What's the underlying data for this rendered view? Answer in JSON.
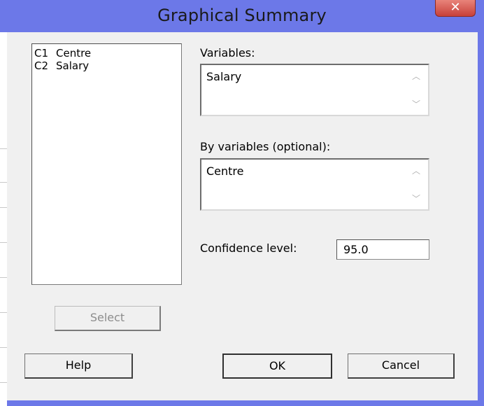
{
  "window": {
    "title": "Graphical Summary",
    "close_label": "✕"
  },
  "variable_list": {
    "items": [
      {
        "column": "C1",
        "name": "Centre"
      },
      {
        "column": "C2",
        "name": "Salary"
      }
    ]
  },
  "variables": {
    "label": "Variables:",
    "value": "Salary"
  },
  "by_variables": {
    "label": "By variables (optional):",
    "value": "Centre"
  },
  "confidence": {
    "label": "Confidence level:",
    "value": "95.0"
  },
  "buttons": {
    "select": "Select",
    "help": "Help",
    "ok": "OK",
    "cancel": "Cancel"
  },
  "colors": {
    "title_bar": "#6c78e8",
    "client_bg": "#f0f0f0",
    "close_button": "#c7403a"
  }
}
